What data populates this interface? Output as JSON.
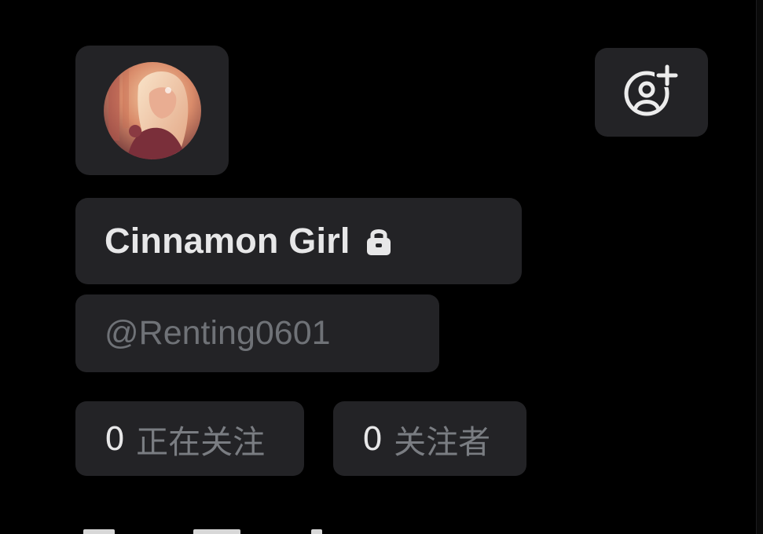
{
  "profile": {
    "display_name": "Cinnamon Girl",
    "handle": "@Renting0601",
    "is_protected": true,
    "avatar_description_icon": "avatar-illustration"
  },
  "actions": {
    "follow_icon": "person-add-icon"
  },
  "stats": {
    "following_count": "0",
    "following_label": "正在关注",
    "followers_count": "0",
    "followers_label": "关注者"
  },
  "theme": {
    "background": "#000000",
    "card": "#232326",
    "primary_text": "#e7e7e8",
    "secondary_text": "#6f7277"
  }
}
